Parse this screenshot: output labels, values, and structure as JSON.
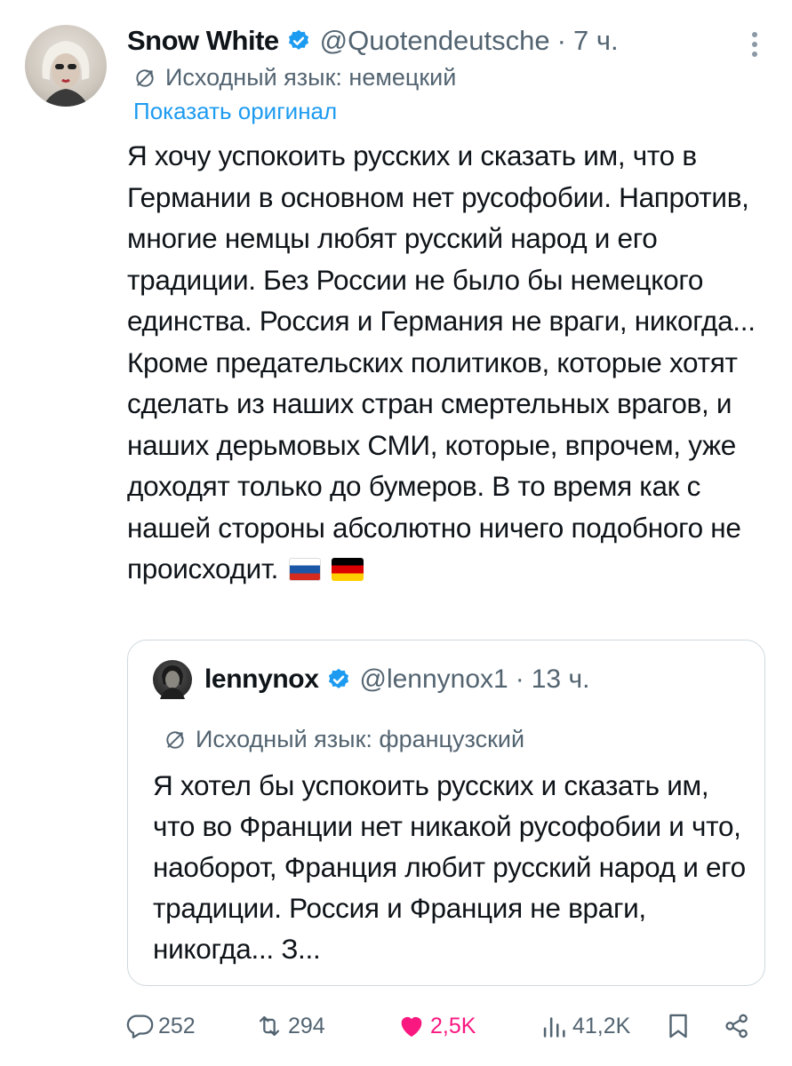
{
  "tweet": {
    "author": {
      "name": "Snow White",
      "handle": "@Quotendeutsche",
      "time": "7 ч.",
      "verified": true
    },
    "translated_from": "Исходный язык: немецкий",
    "show_original": "Показать оригинал",
    "paragraph1": "Я хочу успокоить русских и сказать им, что в Германии в основном нет русофобии. Напротив, многие немцы любят русский народ и его традиции. Без России не было бы немецкого единства. Россия и Германия не враги, никогда...",
    "paragraph2": "Кроме предательских политиков, которые хотят сделать из наших стран смертельных врагов, и наших дерьмовых СМИ, которые, впрочем, уже доходят только до бумеров. В то время как с нашей стороны абсолютно ничего подобного не происходит.",
    "flags": [
      "flag-russia",
      "flag-germany"
    ]
  },
  "quote": {
    "author": {
      "name": "lennynox",
      "handle": "@lennynox1",
      "time": "13 ч.",
      "verified": true
    },
    "translated_from": "Исходный язык: французский",
    "text": "Я хотел бы успокоить русских и сказать им, что во Франции нет никакой русофобии и что, наоборот, Франция любит русский народ и его традиции. Россия и Франция не враги, никогда... З..."
  },
  "actions": {
    "replies": "252",
    "reposts": "294",
    "likes": "2,5K",
    "views": "41,2K"
  },
  "icons": {
    "verified": "verified-badge-icon",
    "more": "more-vertical-icon",
    "translate": "translate-icon",
    "reply": "reply-icon",
    "repost": "repost-icon",
    "like": "heart-icon",
    "views": "views-icon",
    "bookmark": "bookmark-icon",
    "share": "share-icon"
  },
  "colors": {
    "accent": "#1d9bf0",
    "like": "#f91880",
    "secondary_text": "#536471",
    "border": "#cfd9de"
  }
}
